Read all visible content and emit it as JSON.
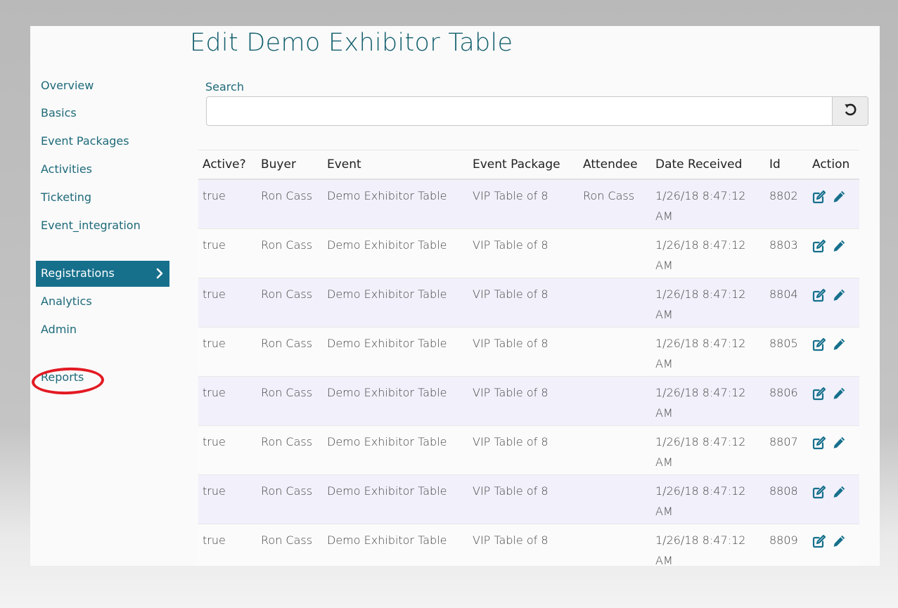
{
  "page": {
    "title": "Edit Demo Exhibitor Table"
  },
  "sidebar": {
    "items": [
      {
        "label": "Overview"
      },
      {
        "label": "Basics"
      },
      {
        "label": "Event Packages"
      },
      {
        "label": "Activities"
      },
      {
        "label": "Ticketing"
      },
      {
        "label": "Event_integration"
      },
      {
        "label": "Registrations",
        "active": true
      },
      {
        "label": "Analytics"
      },
      {
        "label": "Admin"
      },
      {
        "label": "Reports",
        "highlight": "red-circle"
      }
    ],
    "active_icon": "chevron-right-icon"
  },
  "search": {
    "label": "Search",
    "value": "",
    "placeholder": "",
    "reset_icon": "undo-icon"
  },
  "table": {
    "headers": [
      "Active?",
      "Buyer",
      "Event",
      "Event Package",
      "Attendee",
      "Date Received",
      "Id",
      "Action"
    ],
    "action_icons": [
      "edit-square-icon",
      "pencil-icon"
    ],
    "rows": [
      {
        "active": "true",
        "buyer": "Ron Cass",
        "event": "Demo Exhibitor Table",
        "package": "VIP Table of 8",
        "attendee": "Ron Cass",
        "date": "1/26/18 8:47:12 AM",
        "id": "8802"
      },
      {
        "active": "true",
        "buyer": "Ron Cass",
        "event": "Demo Exhibitor Table",
        "package": "VIP Table of 8",
        "attendee": "",
        "date": "1/26/18 8:47:12 AM",
        "id": "8803"
      },
      {
        "active": "true",
        "buyer": "Ron Cass",
        "event": "Demo Exhibitor Table",
        "package": "VIP Table of 8",
        "attendee": "",
        "date": "1/26/18 8:47:12 AM",
        "id": "8804"
      },
      {
        "active": "true",
        "buyer": "Ron Cass",
        "event": "Demo Exhibitor Table",
        "package": "VIP Table of 8",
        "attendee": "",
        "date": "1/26/18 8:47:12 AM",
        "id": "8805"
      },
      {
        "active": "true",
        "buyer": "Ron Cass",
        "event": "Demo Exhibitor Table",
        "package": "VIP Table of 8",
        "attendee": "",
        "date": "1/26/18 8:47:12 AM",
        "id": "8806"
      },
      {
        "active": "true",
        "buyer": "Ron Cass",
        "event": "Demo Exhibitor Table",
        "package": "VIP Table of 8",
        "attendee": "",
        "date": "1/26/18 8:47:12 AM",
        "id": "8807"
      },
      {
        "active": "true",
        "buyer": "Ron Cass",
        "event": "Demo Exhibitor Table",
        "package": "VIP Table of 8",
        "attendee": "",
        "date": "1/26/18 8:47:12 AM",
        "id": "8808"
      },
      {
        "active": "true",
        "buyer": "Ron Cass",
        "event": "Demo Exhibitor Table",
        "package": "VIP Table of 8",
        "attendee": "",
        "date": "1/26/18 8:47:12 AM",
        "id": "8809"
      }
    ]
  },
  "colors": {
    "accent": "#16708c",
    "link": "#1e6a79",
    "title": "#15606e",
    "highlight_ring": "#e31a23",
    "row_stripe": "#f1f0fb"
  }
}
